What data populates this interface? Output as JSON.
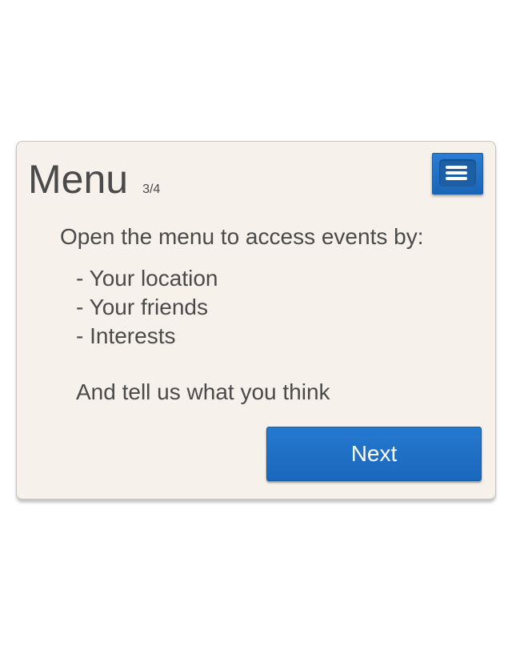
{
  "dialog": {
    "title": "Menu",
    "step": "3/4",
    "intro": "Open the menu to access events by:",
    "items": [
      {
        "label": "- Your location"
      },
      {
        "label": "- Your friends"
      },
      {
        "label": "- Interests"
      }
    ],
    "outro": "And tell us what you think",
    "next_label": "Next",
    "menu_icon": "hamburger-menu-icon"
  },
  "colors": {
    "accent": "#1f6fc5",
    "card_background": "#f7f1eb",
    "text": "#4a4a4a"
  }
}
